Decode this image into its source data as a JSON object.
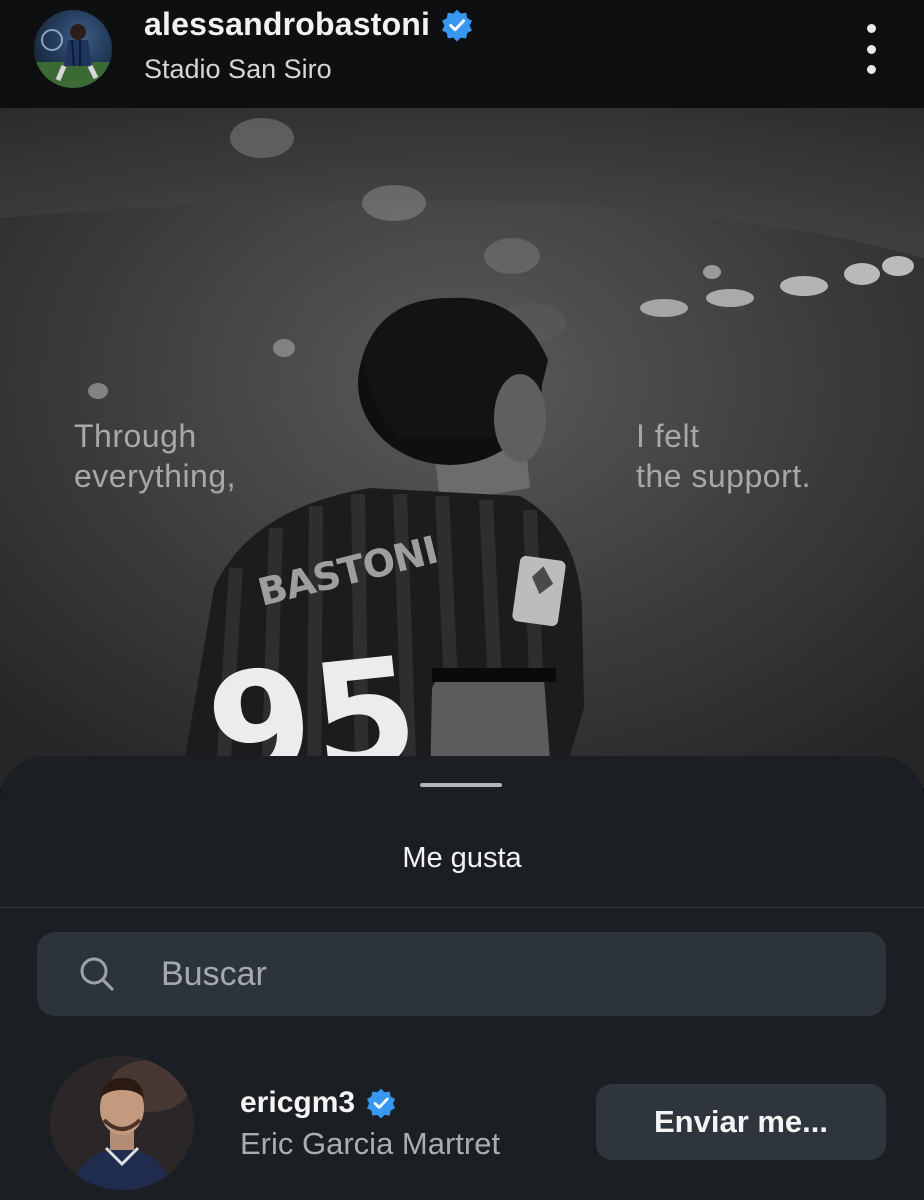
{
  "post_header": {
    "username": "alessandrobastoni",
    "location": "Stadio San Siro",
    "verified_icon": "verified-badge-icon",
    "more_icon": "more-vertical-icon"
  },
  "photo": {
    "quote_left": [
      "Through",
      "everything,"
    ],
    "quote_right": [
      "I felt",
      "the support."
    ],
    "jersey_name": "BASTONI",
    "jersey_number": "95"
  },
  "likes_sheet": {
    "title": "Me gusta",
    "search_placeholder": "Buscar",
    "search_value": "",
    "search_icon": "search-icon",
    "users": [
      {
        "username": "ericgm3",
        "full_name": "Eric Garcia Martret",
        "verified": true,
        "button_label": "Enviar me..."
      }
    ]
  },
  "colors": {
    "header_bg": "#0e0f11",
    "sheet_bg": "#1b1f24",
    "search_bg": "#2d333a",
    "button_bg": "#2f353c",
    "verified_blue": "#3897f0",
    "text_primary": "#f4f4f4",
    "text_secondary": "#a9adb3"
  }
}
